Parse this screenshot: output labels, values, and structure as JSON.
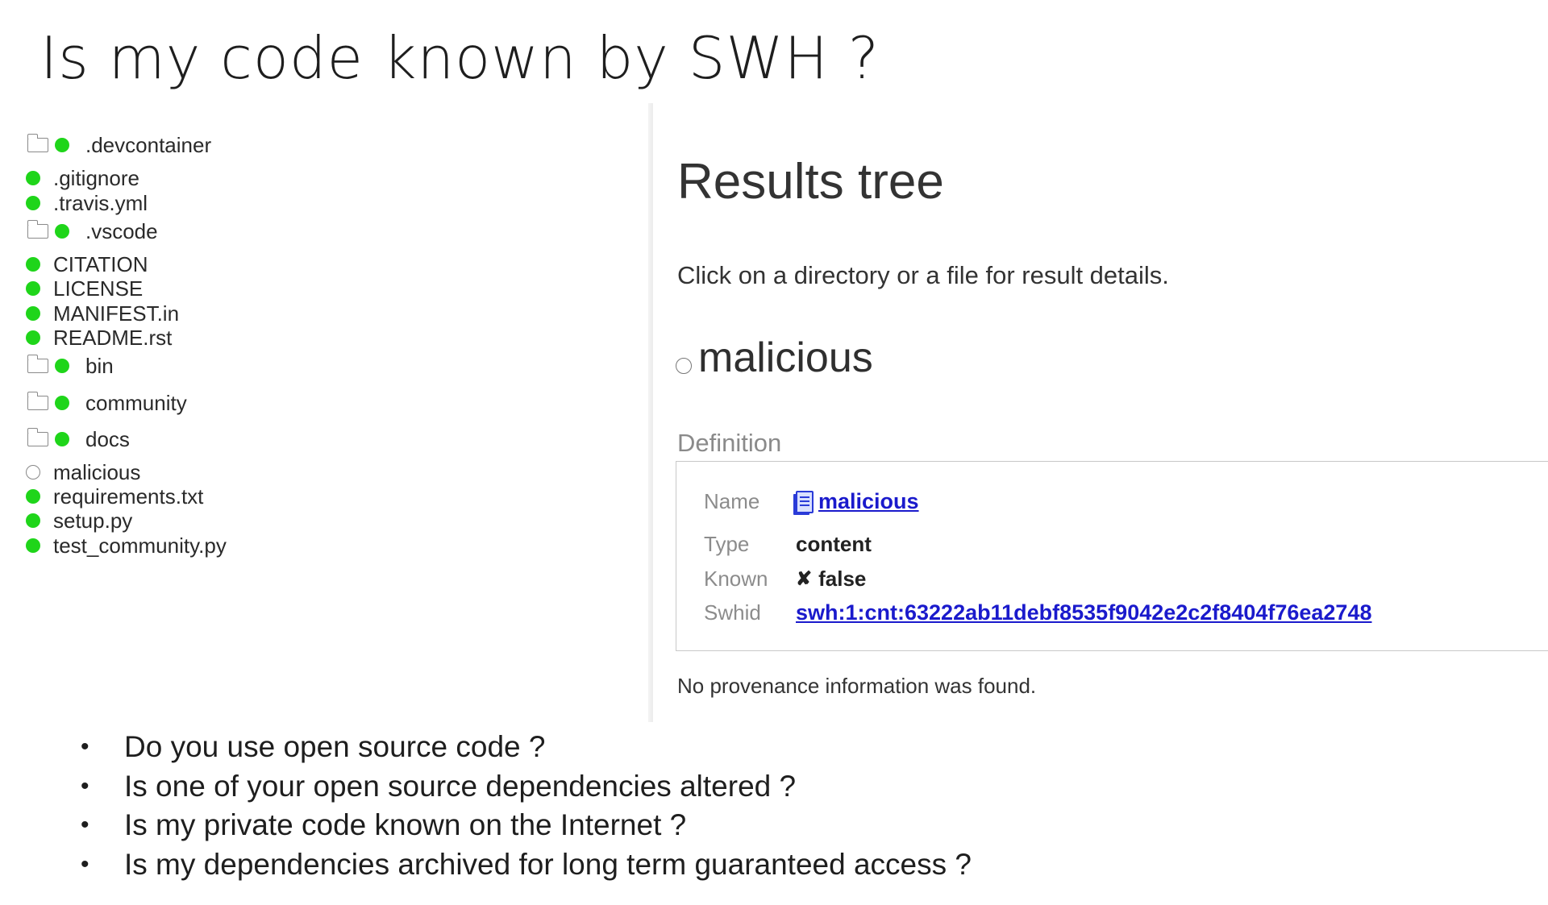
{
  "slide": {
    "title": "Is my code known by SWH ?"
  },
  "tree": {
    "items": [
      {
        "label": ".devcontainer",
        "type": "folder",
        "known": true
      },
      {
        "label": ".gitignore",
        "type": "file",
        "known": true
      },
      {
        "label": ".travis.yml",
        "type": "file",
        "known": true
      },
      {
        "label": ".vscode",
        "type": "folder",
        "known": true
      },
      {
        "label": "CITATION",
        "type": "file",
        "known": true
      },
      {
        "label": "LICENSE",
        "type": "file",
        "known": true
      },
      {
        "label": "MANIFEST.in",
        "type": "file",
        "known": true
      },
      {
        "label": "README.rst",
        "type": "file",
        "known": true
      },
      {
        "label": "bin",
        "type": "folder",
        "known": true
      },
      {
        "label": "community",
        "type": "folder",
        "known": true
      },
      {
        "label": "docs",
        "type": "folder",
        "known": true
      },
      {
        "label": "malicious",
        "type": "file",
        "known": false
      },
      {
        "label": "requirements.txt",
        "type": "file",
        "known": true
      },
      {
        "label": "setup.py",
        "type": "file",
        "known": true
      },
      {
        "label": "test_community.py",
        "type": "file",
        "known": true
      }
    ],
    "known_color": "#1fd51a"
  },
  "results": {
    "title": "Results tree",
    "hint": "Click on a directory or a file for result details.",
    "selected": "malicious",
    "definition_legend": "Definition",
    "definition": {
      "name_key": "Name",
      "name_value": "malicious",
      "type_key": "Type",
      "type_value": "content",
      "known_key": "Known",
      "known_mark": "✘",
      "known_value": "false",
      "swhid_key": "Swhid",
      "swhid_value": "swh:1:cnt:63222ab11debf8535f9042e2c2f8404f76ea2748"
    },
    "provenance": "No provenance information was found.",
    "link_color": "#1a1acc"
  },
  "bullets": [
    "Do you use open source code ?",
    "Is one of your open source dependencies altered ?",
    "Is my private code known on the Internet ?",
    "Is my dependencies archived for long term guaranteed access ?"
  ]
}
